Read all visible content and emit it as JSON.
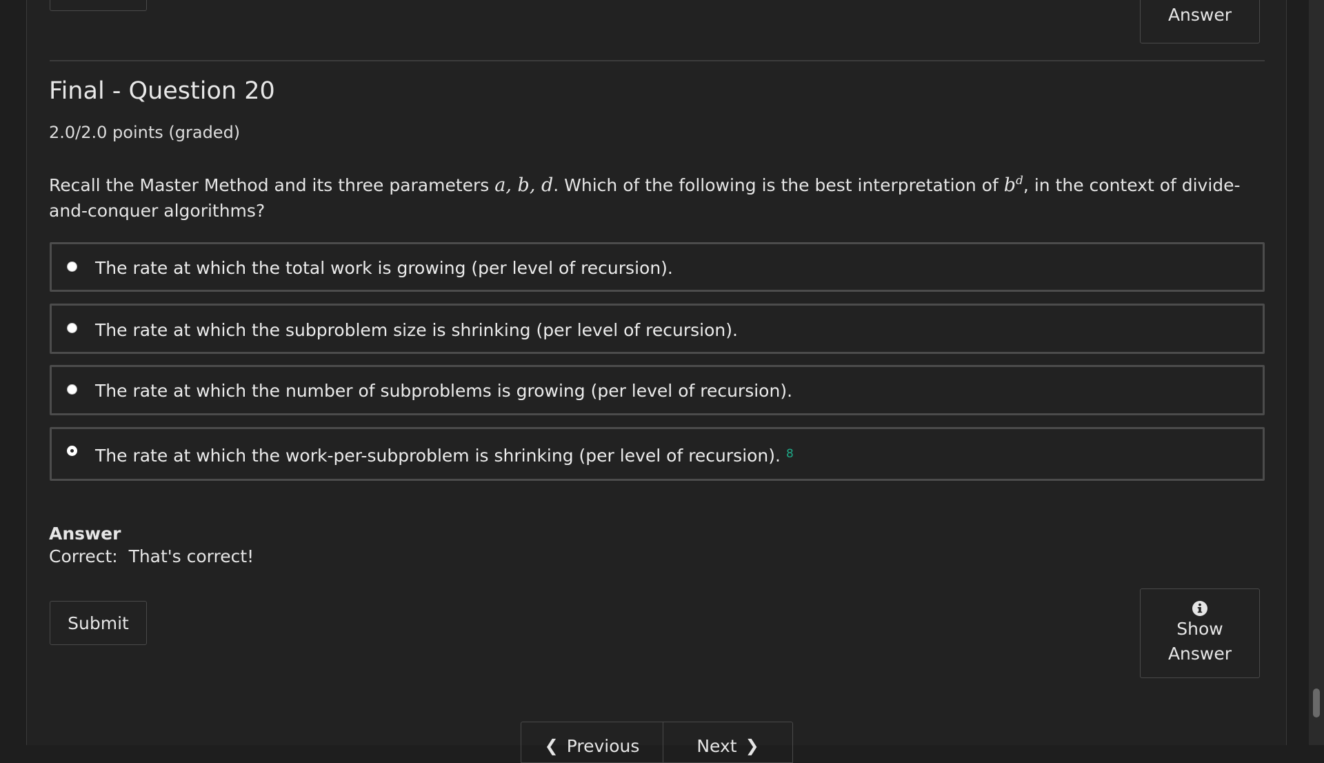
{
  "top_partial": {
    "show_answer_label": "Answer"
  },
  "question": {
    "title": "Final - Question 20",
    "points": "2.0/2.0 points (graded)",
    "prompt_part1": "Recall the Master Method and its three parameters ",
    "prompt_math_params": "a, b, d",
    "prompt_part2": ". Which of the following is the best interpretation of ",
    "prompt_math_base": "b",
    "prompt_math_exp": "d",
    "prompt_part3": ", in the context of divide-and-conquer algorithms?",
    "choices": [
      {
        "label": "The rate at which the total work is growing (per level of recursion).",
        "selected": false
      },
      {
        "label": "The rate at which the subproblem size is shrinking (per level of recursion).",
        "selected": false
      },
      {
        "label": "The rate at which the number of subproblems is growing (per level of recursion).",
        "selected": false
      },
      {
        "label": "The rate at which the work-per-subproblem is shrinking (per level of recursion).",
        "selected": true,
        "status_icon": "check-icon"
      }
    ]
  },
  "answer": {
    "heading": "Answer",
    "text": "Correct:  That's correct!"
  },
  "actions": {
    "submit_label": "Submit",
    "show_answer_label": "Show Answer",
    "show_answer_icon": "info-icon"
  },
  "navigation": {
    "previous_label": "Previous",
    "next_label": "Next"
  },
  "colors": {
    "background": "#222222",
    "border": "#4c4c4c",
    "correct": "#1ea887"
  }
}
